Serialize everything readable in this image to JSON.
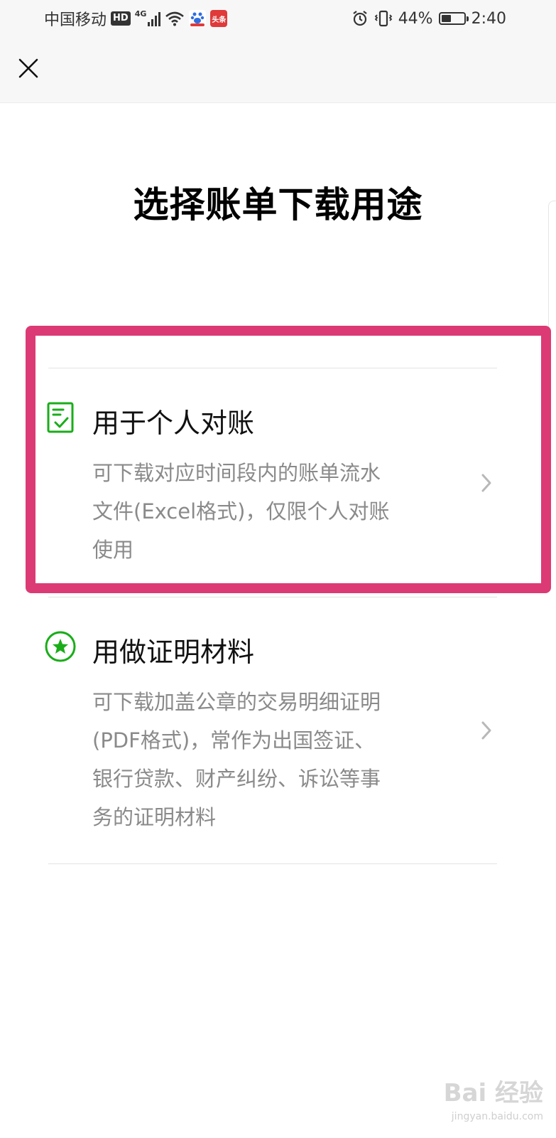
{
  "status_bar": {
    "carrier": "中国移动",
    "hd": "HD",
    "network": "4G",
    "badge_news": "头条",
    "battery_text": "44%",
    "battery_level": 0.44,
    "time": "2:40",
    "icons": [
      "hd-icon",
      "signal-icon",
      "wifi-icon",
      "baidu-app-icon",
      "toutiao-app-icon",
      "alarm-icon",
      "vibrate-icon",
      "battery-icon"
    ]
  },
  "nav": {
    "close_icon": "close-icon"
  },
  "page": {
    "title": "选择账单下载用途"
  },
  "options": [
    {
      "icon": "document-check-icon",
      "title": "用于个人对账",
      "desc_lines": [
        "可下载对应时间段内的账单流水",
        "文件(Excel格式)，仅限个人对账",
        "使用"
      ],
      "chevron_icon": "chevron-right-icon"
    },
    {
      "icon": "star-badge-icon",
      "title": "用做证明材料",
      "desc_lines": [
        "可下载加盖公章的交易明细证明",
        "(PDF格式)，常作为出国签证、",
        "银行贷款、财产纠纷、诉讼等事",
        "务的证明材料"
      ],
      "chevron_icon": "chevron-right-icon"
    }
  ],
  "watermark": {
    "main": "Bai 经验",
    "sub": "jingyan.baidu.com"
  },
  "colors": {
    "accent_green": "#1aad19",
    "highlight": "#dc3a74",
    "desc_gray": "#8a8a8a"
  }
}
